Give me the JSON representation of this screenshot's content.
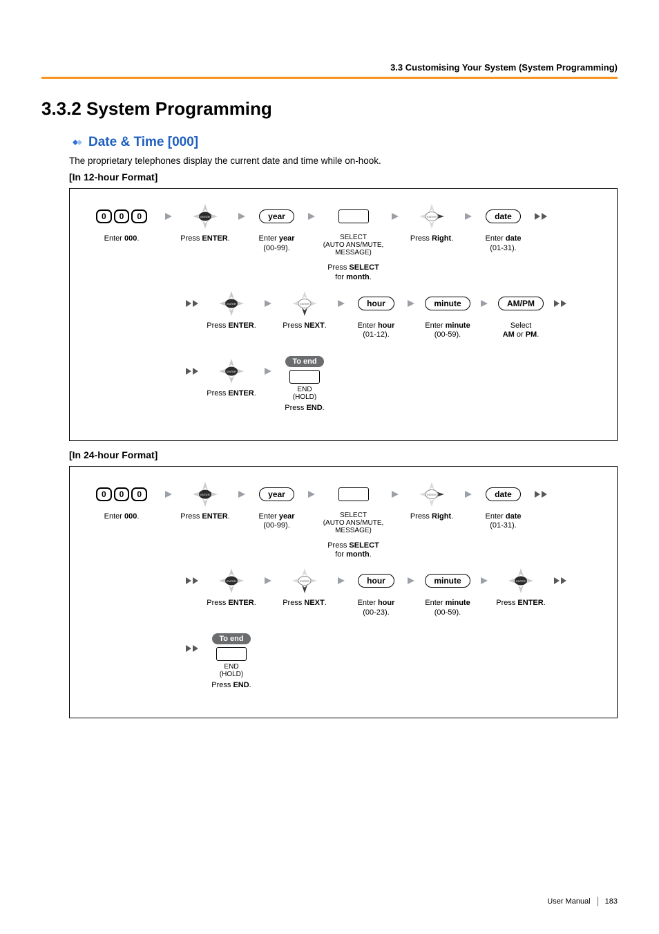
{
  "header": "3.3 Customising Your System (System Programming)",
  "sectionTitle": "3.3.2    System Programming",
  "subHeading": "Date & Time [000]",
  "intro": "The proprietary telephones display the current date and time while on-hook.",
  "format12": "[In 12-hour Format]",
  "format24": "[In 24-hour Format]",
  "key0": "0",
  "enter000": "Enter 000.",
  "pressEnter": "Press ENTER.",
  "yearLabel": "year",
  "enterYear": "Enter year\n(00-99).",
  "selectHeader": "SELECT",
  "selectSub": "(AUTO ANS/MUTE,\nMESSAGE)",
  "pressSelectMonth": "Press SELECT\nfor month.",
  "pressRight": "Press Right.",
  "dateLabel": "date",
  "enterDate": "Enter date\n(01-31).",
  "pressNext": "Press NEXT.",
  "hourLabel": "hour",
  "enterHour12": "Enter hour\n(01-12).",
  "enterHour24": "Enter hour\n(00-23).",
  "minuteLabel": "minute",
  "enterMinute": "Enter minute\n(00-59).",
  "ampmLabel": "AM/PM",
  "selectAmPm": "Select\nAM or PM.",
  "toEnd": "To end",
  "endLabel": "END",
  "holdLabel": "(HOLD)",
  "pressEnd": "Press END.",
  "footerManual": "User Manual",
  "footerPage": "183"
}
